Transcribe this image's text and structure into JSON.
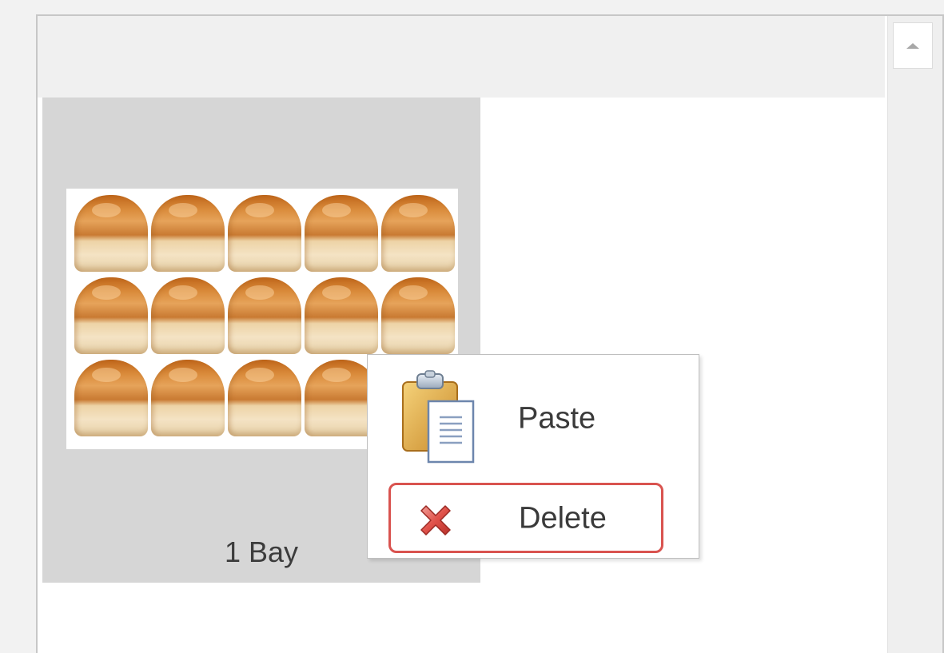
{
  "colors": {
    "panel_background": "#ffffff",
    "header_background": "#f0f0f0",
    "tile_background": "#d6d6d6",
    "highlight_border": "#d9534f"
  },
  "tile": {
    "label": "1 Bay",
    "image_icon": "bread-rolls-image"
  },
  "context_menu": {
    "items": [
      {
        "label": "Paste",
        "icon": "clipboard-paste-icon"
      },
      {
        "label": "Delete",
        "icon": "red-x-delete-icon"
      }
    ]
  },
  "scrollbar": {
    "up_icon": "scroll-up-arrow-icon"
  }
}
